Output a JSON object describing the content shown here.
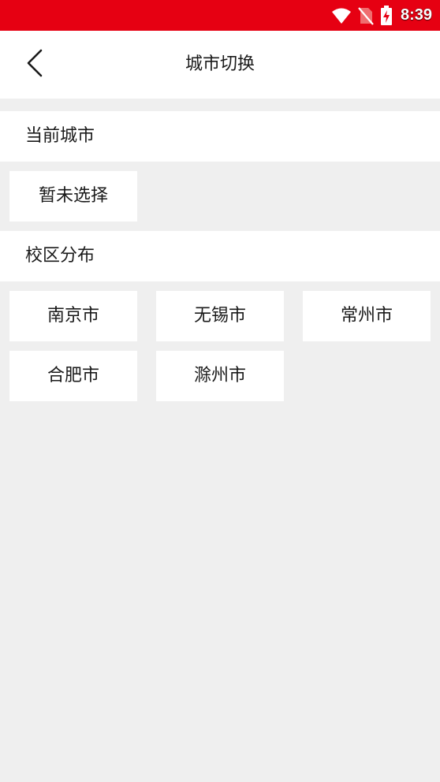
{
  "status_bar": {
    "time": "8:39",
    "icons": [
      "wifi-icon",
      "no-sim-icon",
      "battery-charging-icon"
    ],
    "background_color": "#e60012"
  },
  "header": {
    "back_icon": "chevron-left-icon",
    "title": "城市切换"
  },
  "current_city_section": {
    "label": "当前城市",
    "value": "暂未选择"
  },
  "campus_section": {
    "label": "校区分布",
    "cities": [
      "南京市",
      "无锡市",
      "常州市",
      "合肥市",
      "滁州市"
    ]
  },
  "colors": {
    "page_background": "#efefef",
    "card_background": "#ffffff",
    "text": "#1a1a1a"
  }
}
